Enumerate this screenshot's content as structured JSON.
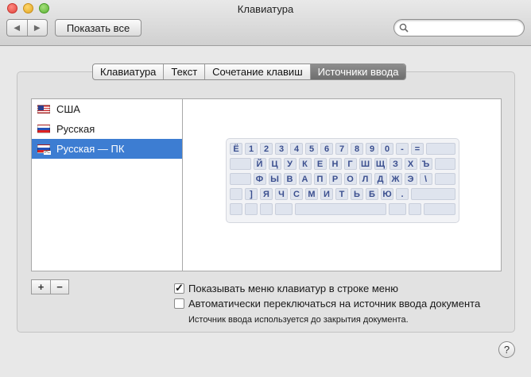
{
  "window": {
    "title": "Клавиатура"
  },
  "toolbar": {
    "back_icon": "◀",
    "forward_icon": "▶",
    "show_all_label": "Показать все",
    "search_placeholder": "",
    "search_value": ""
  },
  "tabs": [
    {
      "label": "Клавиатура",
      "active": false
    },
    {
      "label": "Текст",
      "active": false
    },
    {
      "label": "Сочетание клавиш",
      "active": false
    },
    {
      "label": "Источники ввода",
      "active": true
    }
  ],
  "sources": [
    {
      "label": "США",
      "flag": "us",
      "selected": false
    },
    {
      "label": "Русская",
      "flag": "ru",
      "selected": false
    },
    {
      "label": "Русская — ПК",
      "flag": "ru-pc",
      "selected": true
    }
  ],
  "flag_badge": "PC",
  "keyboard": {
    "rows": [
      [
        "Ё",
        "1",
        "2",
        "3",
        "4",
        "5",
        "6",
        "7",
        "8",
        "9",
        "0",
        "-",
        "="
      ],
      [
        "Й",
        "Ц",
        "У",
        "К",
        "Е",
        "Н",
        "Г",
        "Ш",
        "Щ",
        "З",
        "Х",
        "Ъ"
      ],
      [
        "Ф",
        "Ы",
        "В",
        "А",
        "П",
        "Р",
        "О",
        "Л",
        "Д",
        "Ж",
        "Э",
        "\\"
      ],
      [
        "]",
        "Я",
        "Ч",
        "С",
        "М",
        "И",
        "Т",
        "Ь",
        "Б",
        "Ю",
        "."
      ]
    ]
  },
  "buttons": {
    "add": "+",
    "remove": "−",
    "help": "?"
  },
  "options": {
    "show_menu": {
      "label": "Показывать меню клавиатур в строке меню",
      "checked": true
    },
    "auto_switch": {
      "label": "Автоматически переключаться на источник ввода документа",
      "checked": false
    },
    "note": "Источник ввода используется до закрытия документа."
  },
  "colors": {
    "selection": "#3d7dd2",
    "key_text": "#3b4f8f",
    "tab_active": "#7a7a7a"
  }
}
